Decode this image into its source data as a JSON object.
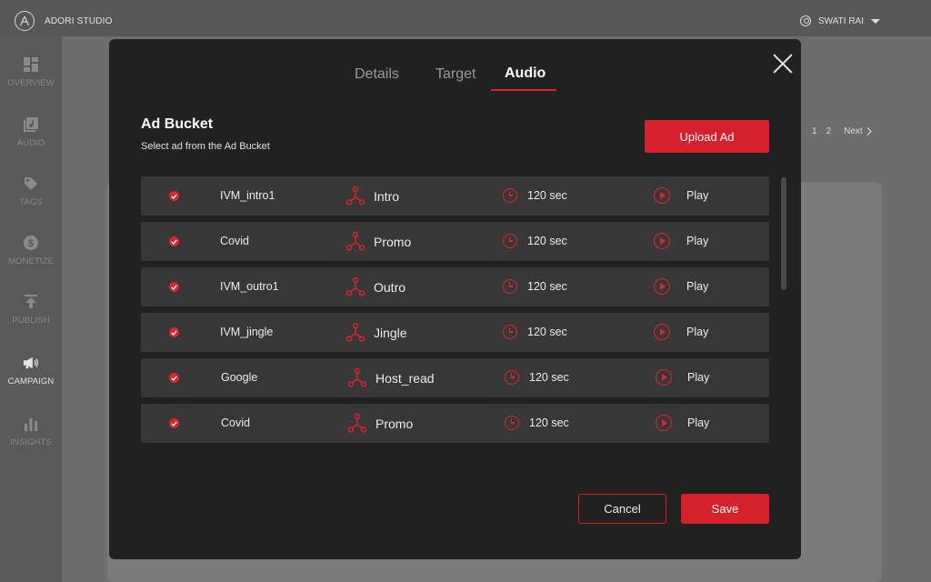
{
  "app": {
    "brand": "ADORI STUDIO",
    "user_name": "SWATI RAI"
  },
  "sidebar": {
    "items": [
      {
        "label": "OVERVIEW",
        "icon": "dashboard-icon"
      },
      {
        "label": "AUDIO",
        "icon": "audio-library-icon"
      },
      {
        "label": "TAGS",
        "icon": "tag-icon"
      },
      {
        "label": "MONETIZE",
        "icon": "dollar-icon"
      },
      {
        "label": "PUBLISH",
        "icon": "upload-icon"
      },
      {
        "label": "CAMPAIGN",
        "icon": "megaphone-icon",
        "active": true
      },
      {
        "label": "INSIGHTS",
        "icon": "bar-chart-icon"
      }
    ]
  },
  "pager": {
    "pages": [
      "1",
      "2"
    ],
    "next": "Next"
  },
  "modal": {
    "tabs": [
      {
        "label": "Details",
        "active": false
      },
      {
        "label": "Target",
        "active": false
      },
      {
        "label": "Audio",
        "active": true
      }
    ],
    "title": "Ad Bucket",
    "subtitle": "Select ad from the Ad Bucket",
    "upload_label": "Upload Ad",
    "ads": [
      {
        "name": "IVM_intro1",
        "type": "Intro",
        "duration": "120 sec",
        "action": "Play"
      },
      {
        "name": "Covid",
        "type": "Promo",
        "duration": "120 sec",
        "action": "Play"
      },
      {
        "name": "IVM_outro1",
        "type": "Outro",
        "duration": "120 sec",
        "action": "Play"
      },
      {
        "name": "IVM_jingle",
        "type": "Jingle",
        "duration": "120 sec",
        "action": "Play"
      },
      {
        "name": "Google",
        "type": "Host_read",
        "duration": "120 sec",
        "action": "Play"
      },
      {
        "name": "Covid",
        "type": "Promo",
        "duration": "120 sec",
        "action": "Play"
      }
    ],
    "cancel_label": "Cancel",
    "save_label": "Save"
  },
  "colors": {
    "accent": "#d6202b",
    "modal_bg": "#212121",
    "row_bg": "#373737"
  }
}
